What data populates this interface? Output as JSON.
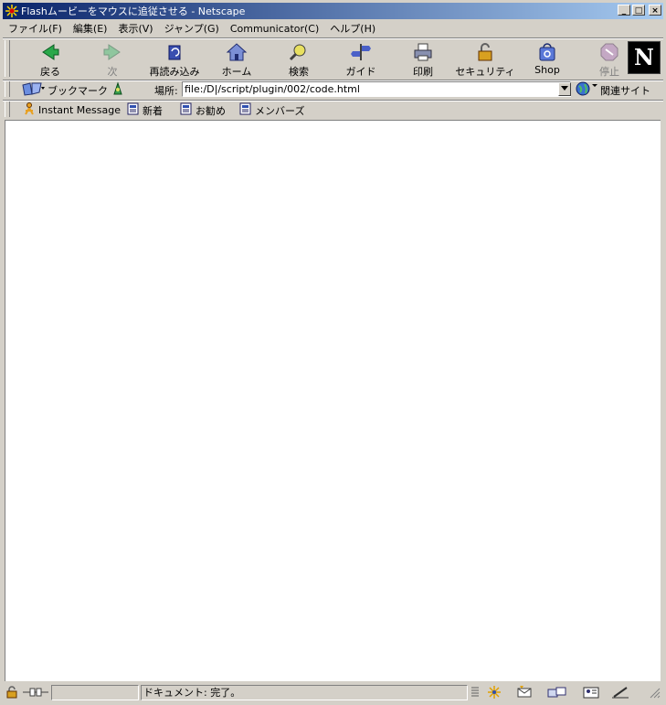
{
  "window": {
    "title": "Flashムービーをマウスに追従させる - Netscape",
    "buttons": {
      "minimize": "_",
      "maximize": "□",
      "close": "×"
    }
  },
  "menubar": {
    "items": [
      {
        "label": "ファイル(F)"
      },
      {
        "label": "編集(E)"
      },
      {
        "label": "表示(V)"
      },
      {
        "label": "ジャンプ(G)"
      },
      {
        "label": "Communicator(C)"
      },
      {
        "label": "ヘルプ(H)"
      }
    ]
  },
  "toolbar": {
    "buttons": [
      {
        "label": "戻る",
        "icon": "back-arrow-icon",
        "enabled": true
      },
      {
        "label": "次",
        "icon": "forward-arrow-icon",
        "enabled": false
      },
      {
        "label": "再読み込み",
        "icon": "reload-icon",
        "enabled": true
      },
      {
        "label": "ホーム",
        "icon": "home-icon",
        "enabled": true
      },
      {
        "label": "検索",
        "icon": "search-icon",
        "enabled": true
      },
      {
        "label": "ガイド",
        "icon": "guide-icon",
        "enabled": true
      },
      {
        "label": "印刷",
        "icon": "printer-icon",
        "enabled": true
      },
      {
        "label": "セキュリティ",
        "icon": "lock-icon",
        "enabled": true
      },
      {
        "label": "Shop",
        "icon": "shop-icon",
        "enabled": true
      },
      {
        "label": "停止",
        "icon": "stop-icon",
        "enabled": false
      }
    ],
    "logo": "N"
  },
  "location": {
    "bookmarks_label": "ブックマーク",
    "location_label": "場所:",
    "url": "file:/D|/script/plugin/002/code.html",
    "related_label": "関連サイト"
  },
  "personal_toolbar": {
    "items": [
      {
        "label": "Instant Message",
        "icon": "instant-message-icon"
      },
      {
        "label": "新着",
        "icon": "bookmark-page-icon"
      },
      {
        "label": "お勧め",
        "icon": "bookmark-page-icon"
      },
      {
        "label": "メンバーズ",
        "icon": "bookmark-page-icon"
      }
    ]
  },
  "status": {
    "text": "ドキュメント: 完了。"
  },
  "colors": {
    "chrome": "#d4d0c8",
    "titlebar_start": "#0a246a",
    "titlebar_end": "#a6caf0",
    "content_bg": "#ffffff"
  }
}
